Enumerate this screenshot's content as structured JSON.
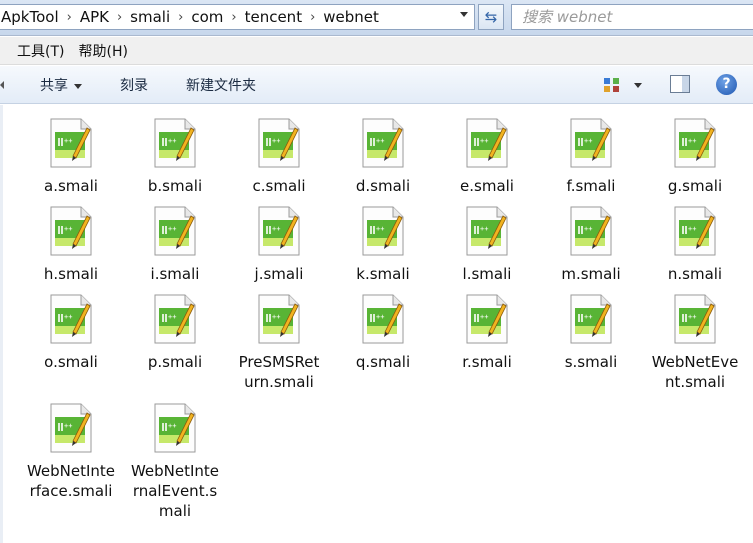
{
  "address_bar": {
    "breadcrumbs": [
      "ApkTool",
      "APK",
      "smali",
      "com",
      "tencent",
      "webnet"
    ],
    "separator": "›"
  },
  "search": {
    "placeholder": "搜索 webnet"
  },
  "menu": {
    "items": [
      "工具(T)",
      "帮助(H)"
    ]
  },
  "command_bar": {
    "share_label": "共享",
    "burn_label": "刻录",
    "new_folder_label": "新建文件夹",
    "help_glyph": "?"
  },
  "files": [
    {
      "name": "a.smali"
    },
    {
      "name": "b.smali"
    },
    {
      "name": "c.smali"
    },
    {
      "name": "d.smali"
    },
    {
      "name": "e.smali"
    },
    {
      "name": "f.smali"
    },
    {
      "name": "g.smali"
    },
    {
      "name": "h.smali"
    },
    {
      "name": "i.smali"
    },
    {
      "name": "j.smali"
    },
    {
      "name": "k.smali"
    },
    {
      "name": "l.smali"
    },
    {
      "name": "m.smali"
    },
    {
      "name": "n.smali"
    },
    {
      "name": "o.smali"
    },
    {
      "name": "p.smali"
    },
    {
      "name": "PreSMSReturn.smali"
    },
    {
      "name": "q.smali"
    },
    {
      "name": "r.smali"
    },
    {
      "name": "s.smali"
    },
    {
      "name": "WebNetEvent.smali"
    },
    {
      "name": "WebNetInterface.smali"
    },
    {
      "name": "WebNetInternalEvent.smali"
    }
  ],
  "colors": {
    "accent": "#3566a8",
    "icon_green": "#4caf2e",
    "icon_pencil": "#e8a21a"
  },
  "icons": {
    "file": "notepad-plus-document-icon",
    "refresh": "refresh-icon",
    "help": "help-icon"
  }
}
